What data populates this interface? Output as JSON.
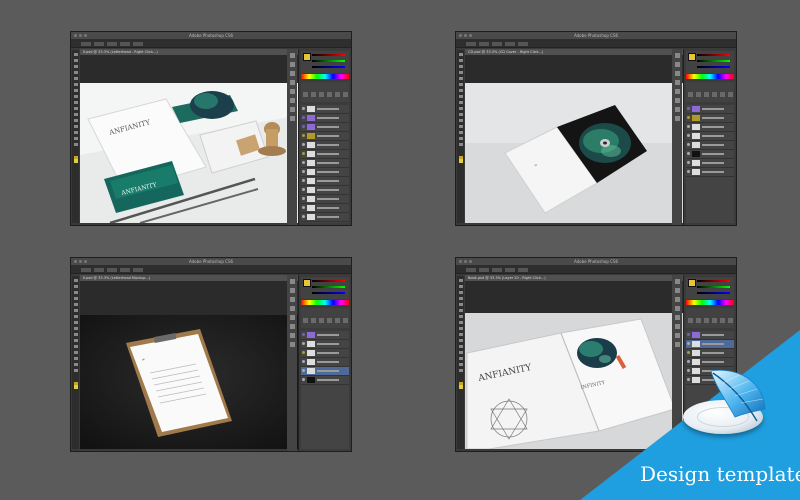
{
  "app_title": "Adobe Photoshop CS6",
  "windows": [
    {
      "id": "stationery",
      "doc_tab": "II.psd @ 33.3% (Letterhead - Right Click...)",
      "title": "Adobe Photoshop CS6",
      "scene": "Stationery mockup with ∞ INFINITY branding: letterhead, business cards, pencils and stamp"
    },
    {
      "id": "cd",
      "doc_tab": "CD.psd @ 33.3% (CD Cover - Right Click...)",
      "title": "Adobe Photoshop CS6",
      "scene": "CD case mockup with green galaxy disc and ∞ logo insert"
    },
    {
      "id": "clipboard",
      "doc_tab": "II.psd @ 33.3% (Letterhead Mockup...)",
      "title": "Adobe Photoshop CS6",
      "scene": "Clipboard letterhead mockup on dark background"
    },
    {
      "id": "book",
      "doc_tab": "Book.psd @ 33.3% (Layer 20 - Right Click...)",
      "title": "Adobe Photoshop CS6",
      "scene": "Open book mockup with INFINITY logo, geometric sketch and galaxy artwork"
    }
  ],
  "badge_label": "Design templates",
  "icons": {
    "badge": "feather-quill-icon"
  },
  "colors": {
    "ribbon": "#1f9fe0",
    "background": "#5b5b5b",
    "foreground_swatch": "#e7c53a"
  }
}
